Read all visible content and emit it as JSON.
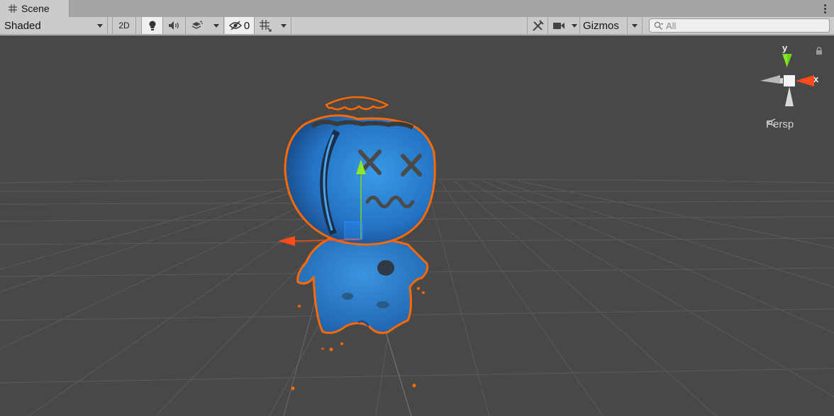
{
  "tab": {
    "title": "Scene",
    "icon": "grid-icon"
  },
  "toolbar": {
    "shading_mode": "Shaded",
    "mode_2d": "2D",
    "hidden_count": "0",
    "gizmos_label": "Gizmos",
    "search_placeholder": "All"
  },
  "viewport": {
    "projection_label": "Persp",
    "axis_x": "x",
    "axis_y": "y",
    "selection_color": "#ff6a00",
    "character_color": "#2a7fd4",
    "background_color": "#484848"
  }
}
